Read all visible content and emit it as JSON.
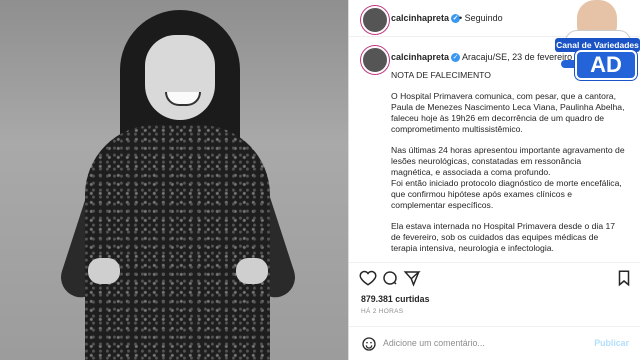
{
  "post": {
    "username": "calcinhapreta",
    "follow_status": "Seguindo",
    "location_date": "Aracaju/SE, 23 de fevereiro d",
    "caption_title": "NOTA DE FALECIMENTO",
    "paragraphs": [
      "O Hospital Primavera comunica, com pesar, que a cantora, Paula de Menezes Nascimento Leca Viana, Paulinha Abelha, faleceu hoje às 19h26 em decorrência de um quadro de comprometimento multissistêmico.",
      "Nas últimas 24 horas apresentou importante agravamento de lesões neurológicas, constatadas em ressonância magnética, e associada a coma profundo.\nFoi então iniciado protocolo diagnóstico de morte encefálica, que confirmou hipótese após exames clínicos e complementar específicos.",
      "Ela estava internada no Hospital Primavera desde o dia 17 de fevereiro, sob os cuidados das equipes médicas de terapia intensiva, neurologia e infectologia."
    ],
    "likes": "879.381 curtidas",
    "time_ago": "HÁ 2 HORAS",
    "comment_placeholder": "Adicione um comentário...",
    "post_button": "Publicar",
    "more_icon": "ellipsis-icon"
  },
  "watermark": {
    "ribbon": "Canal de Variedades",
    "letters": "AD"
  },
  "colors": {
    "accent": "#3897f0",
    "brand_blue": "#1a53c6"
  }
}
